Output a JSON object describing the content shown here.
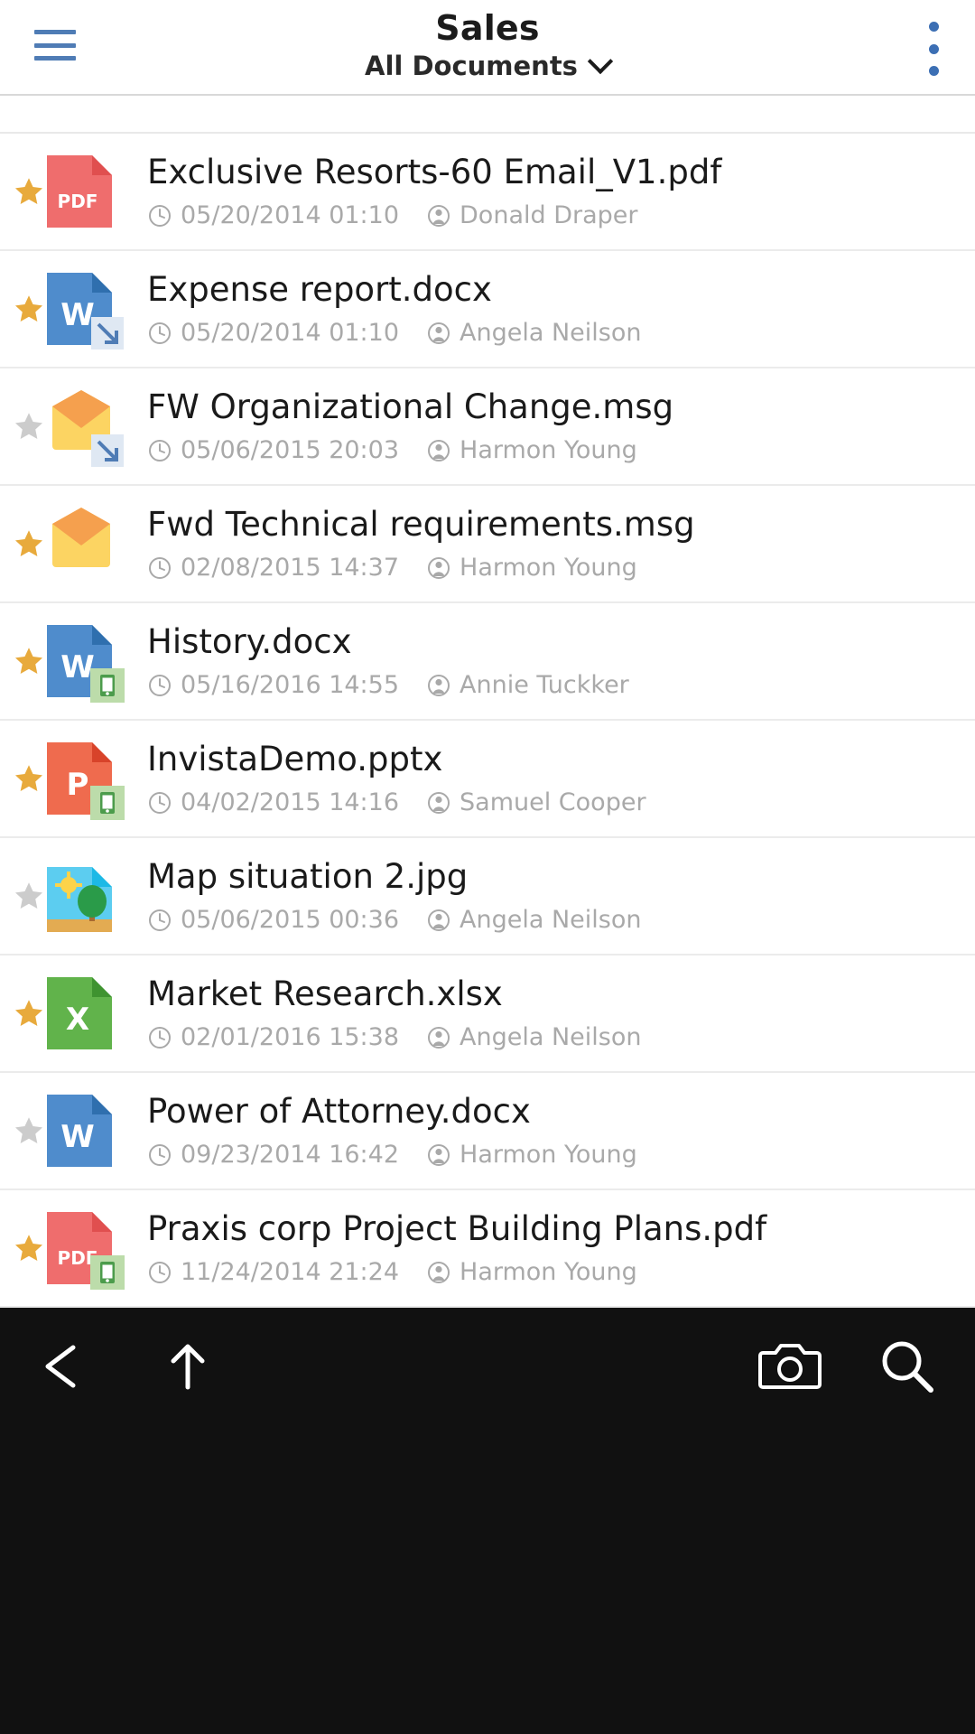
{
  "header": {
    "menu_icon": "hamburger-icon",
    "title": "Sales",
    "subtitle": "All Documents",
    "subtitle_chevron": "chevron-down-icon",
    "overflow_icon": "kebab-menu-icon"
  },
  "list": {
    "clock_icon": "clock-icon",
    "author_icon": "person-icon",
    "items": [
      {
        "name": "Exclusive Resorts-60 Email_V1.pdf",
        "date": "05/20/2014 01:10",
        "author": "Donald Draper",
        "type": "pdf",
        "label": "PDF",
        "starred": true,
        "badge": "none"
      },
      {
        "name": "Expense report.docx",
        "date": "05/20/2014 01:10",
        "author": "Angela Neilson",
        "type": "word",
        "label": "W",
        "starred": true,
        "badge": "shortcut"
      },
      {
        "name": "FW Organizational Change.msg",
        "date": "05/06/2015 20:03",
        "author": "Harmon Young",
        "type": "email",
        "label": "",
        "starred": false,
        "badge": "shortcut"
      },
      {
        "name": "Fwd Technical requirements.msg",
        "date": "02/08/2015 14:37",
        "author": "Harmon Young",
        "type": "email",
        "label": "",
        "starred": true,
        "badge": "none"
      },
      {
        "name": "History.docx",
        "date": "05/16/2016 14:55",
        "author": "Annie Tuckker",
        "type": "word",
        "label": "W",
        "starred": true,
        "badge": "mobile"
      },
      {
        "name": "InvistaDemo.pptx",
        "date": "04/02/2015 14:16",
        "author": "Samuel Cooper",
        "type": "powerpoint",
        "label": "P",
        "starred": true,
        "badge": "mobile"
      },
      {
        "name": "Map situation 2.jpg",
        "date": "05/06/2015 00:36",
        "author": "Angela Neilson",
        "type": "image",
        "label": "",
        "starred": false,
        "badge": "none"
      },
      {
        "name": "Market Research.xlsx",
        "date": "02/01/2016 15:38",
        "author": "Angela Neilson",
        "type": "excel",
        "label": "X",
        "starred": true,
        "badge": "none"
      },
      {
        "name": "Power of Attorney.docx",
        "date": "09/23/2014 16:42",
        "author": "Harmon Young",
        "type": "word",
        "label": "W",
        "starred": false,
        "badge": "none"
      },
      {
        "name": "Praxis corp Project Building Plans.pdf",
        "date": "11/24/2014 21:24",
        "author": "Harmon Young",
        "type": "pdf",
        "label": "PDF",
        "starred": true,
        "badge": "mobile"
      }
    ]
  },
  "bottombar": {
    "buttons": [
      {
        "icon": "back-arrow-icon",
        "name": "back-button"
      },
      {
        "icon": "upload-arrow-icon",
        "name": "upload-button"
      },
      {
        "icon": "camera-icon",
        "name": "camera-button"
      },
      {
        "icon": "search-icon",
        "name": "search-button"
      }
    ]
  },
  "colors": {
    "accent_blue": "#4f7cb5",
    "pdf_red": "#ef6d6d",
    "word_blue": "#4f8ccc",
    "excel_green": "#61b34b",
    "ppt_orange": "#ef6b4e",
    "email_orange": "#f5a04e",
    "email_yellow": "#fcd462",
    "star_gold": "#e8aa3c",
    "star_gray": "#cccccc",
    "meta_gray": "#a9a9a9",
    "bottombar_bg": "#111111"
  }
}
